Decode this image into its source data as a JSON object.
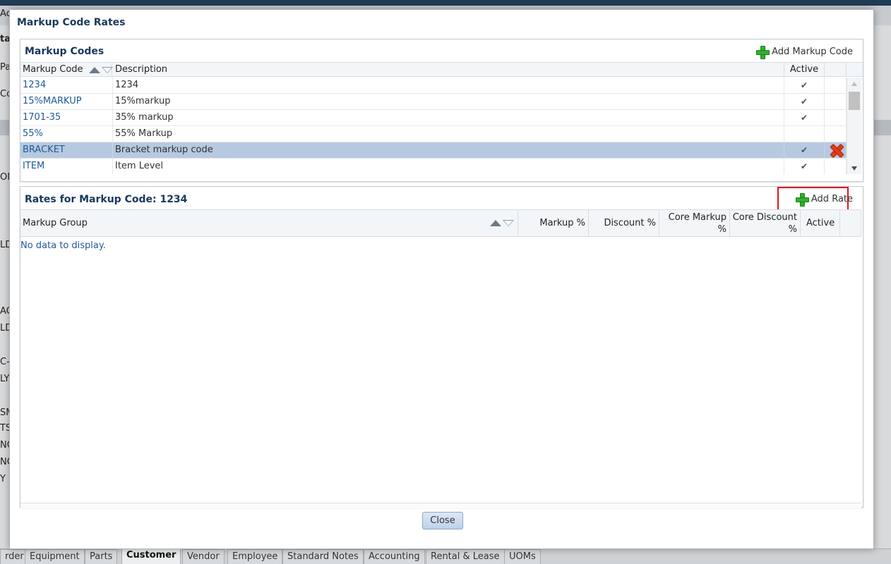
{
  "background": {
    "left_fragments": [
      "Ac",
      "tar",
      "Pa",
      "Co",
      "ON",
      "LD",
      "AC",
      "LD",
      "C-I",
      "LY",
      "SM",
      "TS",
      "NO",
      "NO",
      "Y"
    ],
    "tabs": [
      {
        "label": "rder",
        "active": false
      },
      {
        "label": "Equipment",
        "active": false
      },
      {
        "label": "Parts",
        "active": false
      },
      {
        "label": "Customer",
        "active": true
      },
      {
        "label": "Vendor",
        "active": false
      },
      {
        "label": "Employee",
        "active": false
      },
      {
        "label": "Standard Notes",
        "active": false
      },
      {
        "label": "Accounting",
        "active": false
      },
      {
        "label": "Rental & Lease",
        "active": false
      },
      {
        "label": "UOMs",
        "active": false
      }
    ]
  },
  "dialog": {
    "title": "Markup Code Rates",
    "close_label": "Close"
  },
  "markup_codes": {
    "title": "Markup Codes",
    "add_label": "Add Markup Code",
    "columns": {
      "code": "Markup Code",
      "description": "Description",
      "active": "Active"
    },
    "rows": [
      {
        "code": "1234",
        "description": "1234",
        "active": true
      },
      {
        "code": "15%MARKUP",
        "description": "15%markup",
        "active": true
      },
      {
        "code": "1701-35",
        "description": "35% markup",
        "active": true
      },
      {
        "code": "55%",
        "description": "55% Markup",
        "active": false
      },
      {
        "code": "BRACKET",
        "description": "Bracket markup code",
        "active": true,
        "selected": true
      },
      {
        "code": "ITEM",
        "description": "Item Level",
        "active": true
      }
    ]
  },
  "rates": {
    "title": "Rates for Markup Code: 1234",
    "add_label": "Add Rate",
    "columns": {
      "group": "Markup Group",
      "markup": "Markup %",
      "discount": "Discount %",
      "core_markup_1": "Core Markup",
      "core_markup_2": "%",
      "core_discount_1": "Core Discount",
      "core_discount_2": "%",
      "active": "Active"
    },
    "empty_text": "No data to display."
  },
  "colors": {
    "accent_highlight": "#e0151b",
    "selected_row": "#b7c9e0",
    "link": "#1f5a96",
    "title": "#17385c"
  },
  "icons": {
    "add": "plus-icon",
    "delete": "delete-x-icon",
    "active": "checkmark-icon",
    "sort": "sort-arrows-icon"
  }
}
